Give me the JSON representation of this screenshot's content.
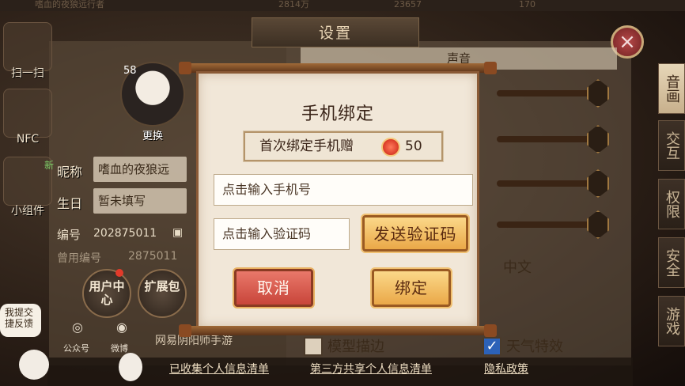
{
  "top_strip": [
    "嗜血的夜狼远行者",
    "2814万",
    "23657",
    "170"
  ],
  "settings_panel": {
    "title": "设置",
    "close_label": "×",
    "left_tools": [
      "扫一扫",
      "NFC",
      "小组件"
    ],
    "avatar_level": "58",
    "avatar_change": "更换",
    "new_badge": "新",
    "nickname_label": "昵称",
    "nickname_value": "嗜血的夜狼远",
    "birthday_label": "生日",
    "birthday_value": "暂未填写",
    "id_label": "编号",
    "id_value": "202875011",
    "old_id_label": "曾用编号",
    "old_id_value": "2875011",
    "user_center": "用户中心",
    "expand_pack": "扩展包",
    "feedback": "我提交捷反馈",
    "wechat": "公众号",
    "weibo": "微博",
    "netease": "网易阴阳师手游",
    "section_header": "声音",
    "language": "中文",
    "model_outline": "模型描边",
    "weather_effect": "天气特效",
    "right_tabs": [
      "音画",
      "交互",
      "权限",
      "安全",
      "游戏"
    ],
    "bottom_links": [
      "已收集个人信息清单",
      "第三方共享个人信息清单",
      "隐私政策"
    ]
  },
  "bind_dialog": {
    "title": "手机绑定",
    "bonus_text": "首次绑定手机赠",
    "bonus_amount": "50",
    "phone_placeholder": "点击输入手机号",
    "code_placeholder": "点击输入验证码",
    "send_code": "发送验证码",
    "cancel": "取消",
    "confirm": "绑定"
  },
  "colors": {
    "cancel_button": "#d65a4c",
    "confirm_button": "#f4c46c",
    "paper": "#f1e7d8"
  }
}
